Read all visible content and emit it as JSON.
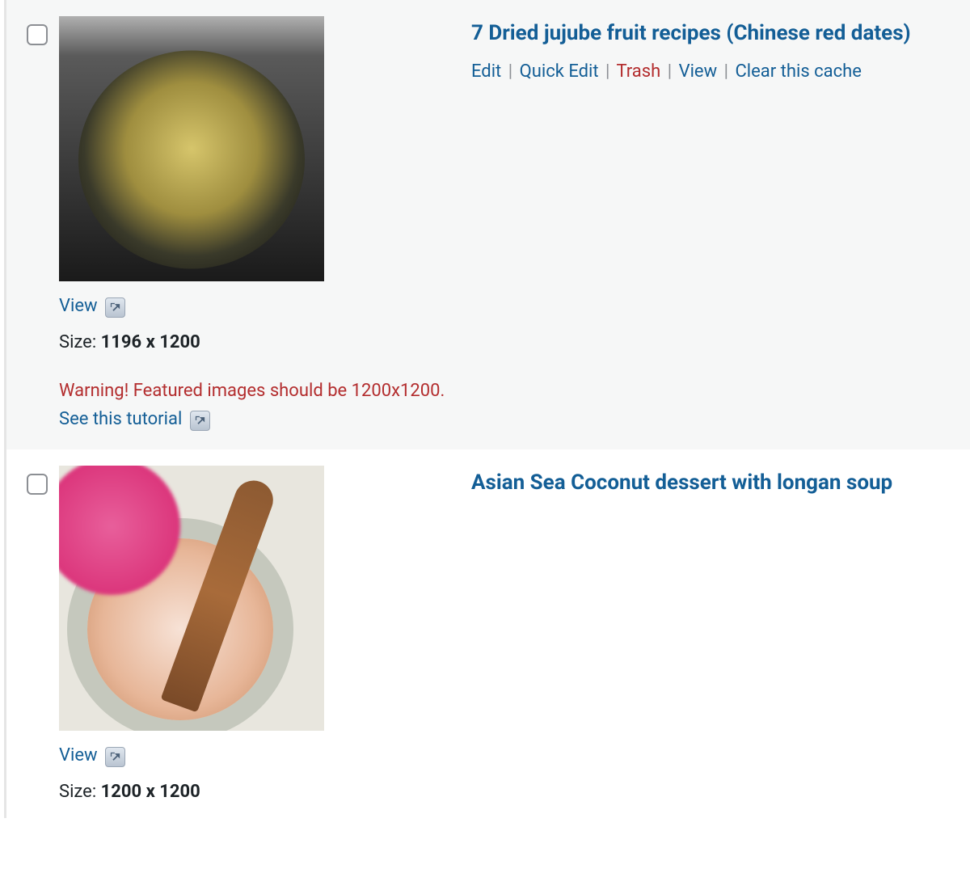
{
  "common": {
    "view_label": "View",
    "size_prefix": "Size:"
  },
  "actions": {
    "edit": "Edit",
    "quick_edit": "Quick Edit",
    "trash": "Trash",
    "view": "View",
    "clear_cache": "Clear this cache"
  },
  "rows": [
    {
      "title": "7 Dried jujube fruit recipes (Chinese red dates)",
      "size": "1196 x 1200",
      "warning_text": "Warning! Featured images should be 1200x1200.",
      "tutorial_label": "See this tutorial",
      "has_warning": true,
      "show_actions": true
    },
    {
      "title": "Asian Sea Coconut dessert with longan soup",
      "size": "1200 x 1200",
      "has_warning": false,
      "show_actions": false
    }
  ]
}
